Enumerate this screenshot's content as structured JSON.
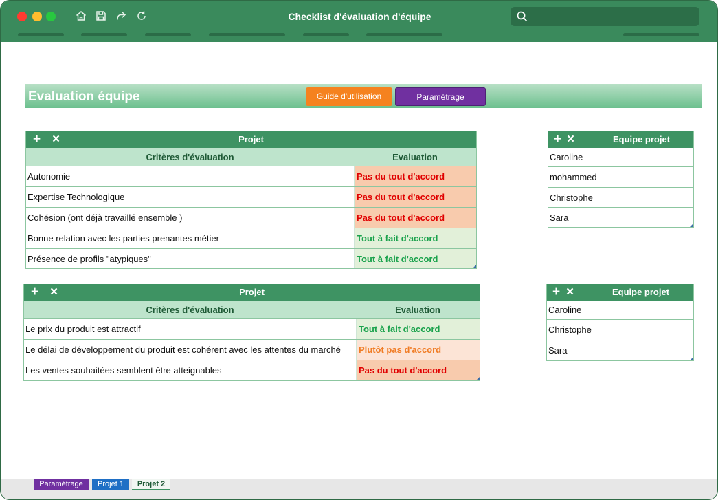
{
  "window": {
    "title": "Checklist d'évaluation d'équipe",
    "toolbar_icons": [
      "home-icon",
      "save-icon",
      "share-icon",
      "refresh-icon"
    ]
  },
  "header": {
    "title": "Evaluation équipe",
    "guide_label": "Guide d'utilisation",
    "param_label": "Paramétrage"
  },
  "colors": {
    "accent": "#3e9363",
    "guide": "#f5821f",
    "param": "#7030a0",
    "negative_text": "#e00000",
    "positive_text": "#1aa24c",
    "moderate_text": "#f07c24"
  },
  "project1": {
    "title": "Projet",
    "col_criteria": "Critères d'évaluation",
    "col_eval": "Evaluation",
    "rows": [
      {
        "criterion": "Autonomie",
        "evaluation": "Pas du tout d'accord"
      },
      {
        "criterion": "Expertise Technologique",
        "evaluation": "Pas du tout d'accord"
      },
      {
        "criterion": "Cohésion (ont déjà travaillé ensemble )",
        "evaluation": "Pas du tout d'accord"
      },
      {
        "criterion": "Bonne relation avec les parties prenantes métier",
        "evaluation": "Tout à fait d'accord"
      },
      {
        "criterion": "Présence de profils \"atypiques\"",
        "evaluation": "Tout à fait d'accord"
      }
    ]
  },
  "team1": {
    "title": "Equipe projet",
    "members": [
      "Caroline",
      "mohammed",
      "Christophe",
      "Sara"
    ]
  },
  "project2": {
    "title": "Projet",
    "col_criteria": "Critères d'évaluation",
    "col_eval": "Evaluation",
    "rows": [
      {
        "criterion": "Le prix du produit est attractif",
        "evaluation": "Tout à fait d'accord"
      },
      {
        "criterion": "Le délai de développement du produit est cohérent avec les attentes du marché",
        "evaluation": "Plutôt pas d'accord"
      },
      {
        "criterion": "Les ventes souhaitées semblent être atteignables",
        "evaluation": "Pas du tout d'accord"
      }
    ]
  },
  "team2": {
    "title": "Equipe projet",
    "members": [
      "Caroline",
      "Christophe",
      "Sara"
    ]
  },
  "sheets": {
    "tabs": [
      "Paramétrage",
      "Projet 1",
      "Projet 2"
    ],
    "active": "Projet 2"
  }
}
